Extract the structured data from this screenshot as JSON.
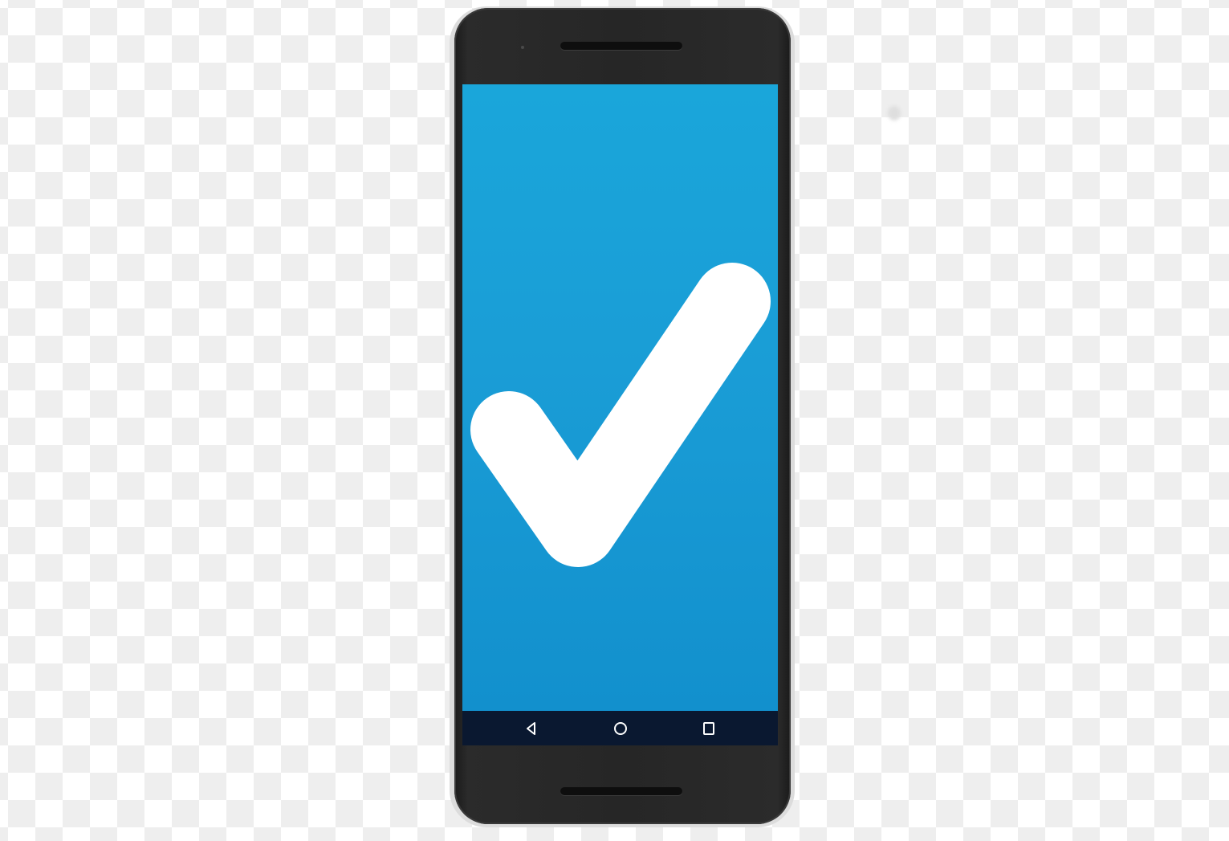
{
  "image": {
    "background": "transparency-checkerboard",
    "subject": "smartphone"
  },
  "phone": {
    "body_color": "#262626",
    "screen": {
      "background_color": "#1a9dd6",
      "icon": "checkmark-icon",
      "icon_color": "#ffffff"
    },
    "navbar": {
      "background_color": "#0a1830",
      "buttons": [
        {
          "icon": "back-triangle-icon"
        },
        {
          "icon": "home-circle-icon"
        },
        {
          "icon": "recent-apps-square-icon"
        }
      ]
    }
  }
}
